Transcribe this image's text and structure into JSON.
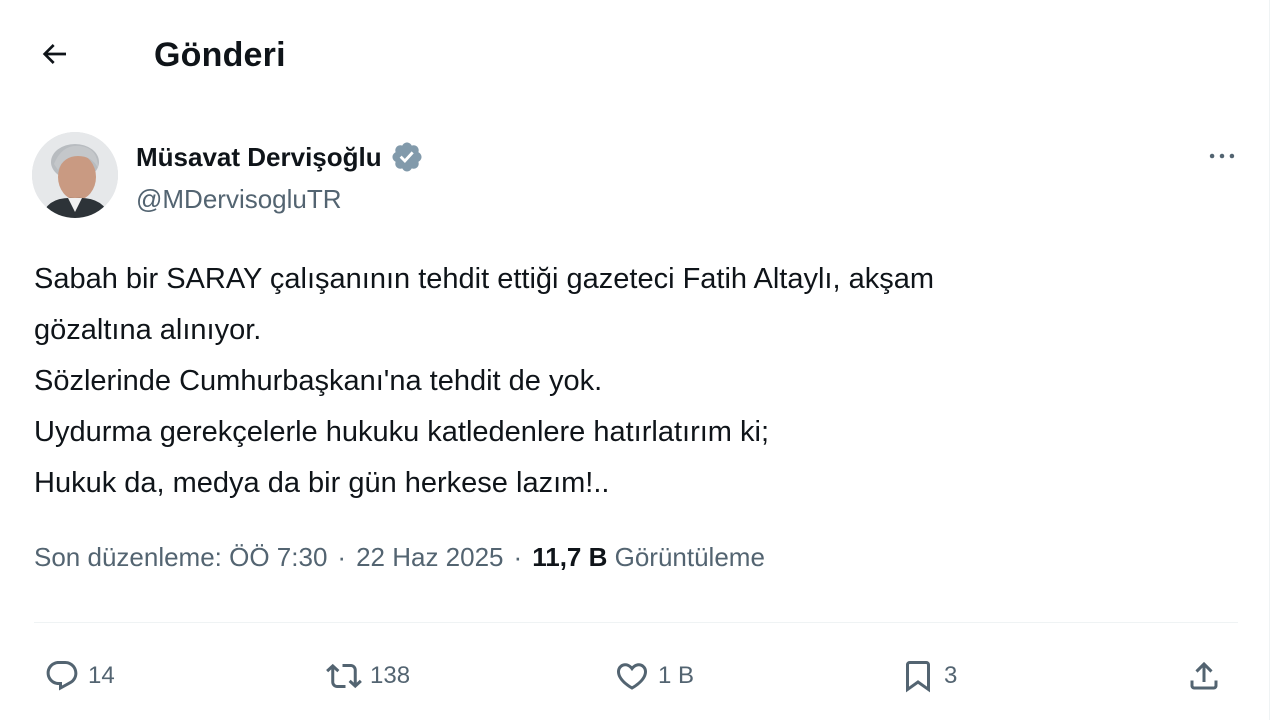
{
  "header": {
    "title": "Gönderi",
    "back_icon": "arrow-left-icon"
  },
  "author": {
    "display_name": "Müsavat Dervişoğlu",
    "handle": "@MDervisogluTR",
    "verified_icon": "verified-badge-icon",
    "verified_color": "#829aab",
    "more_icon": "more-horizontal-icon"
  },
  "tweet": {
    "lines": [
      "Sabah bir SARAY çalışanının tehdit ettiği gazeteci Fatih Altaylı, akşam",
      "gözaltına alınıyor.",
      "Sözlerinde Cumhurbaşkanı'na tehdit de yok.",
      "Uydurma gerekçelerle hukuku katledenlere hatırlatırım ki;",
      "Hukuk da, medya da bir gün herkese lazım!.."
    ]
  },
  "meta": {
    "edited": "Son düzenleme: ÖÖ 7:30",
    "sep1": "·",
    "date": "22 Haz 2025",
    "sep2": "·",
    "views_count": "11,7 B",
    "views_label": "Görüntüleme"
  },
  "actions": {
    "reply": {
      "icon": "reply-icon",
      "count": "14"
    },
    "repost": {
      "icon": "repost-icon",
      "count": "138"
    },
    "like": {
      "icon": "heart-icon",
      "count": "1 B"
    },
    "bookmark": {
      "icon": "bookmark-icon",
      "count": "3"
    },
    "share": {
      "icon": "share-icon"
    }
  },
  "colors": {
    "text": "#0f1419",
    "secondary": "#536471",
    "divider": "#eff3f4"
  }
}
